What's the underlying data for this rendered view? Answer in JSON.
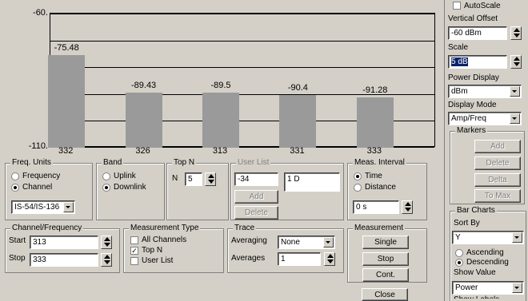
{
  "chart_data": {
    "type": "bar",
    "categories": [
      "332",
      "326",
      "313",
      "331",
      "333"
    ],
    "values": [
      -75.48,
      -89.43,
      -89.5,
      -90.4,
      -91.28
    ],
    "value_labels": [
      "-75.48",
      "-89.43",
      "-89.5",
      "-90.4",
      "-91.28"
    ],
    "ytick_top": "-60.",
    "ytick_bottom": "-110.",
    "ylim": [
      -110,
      -60
    ],
    "gridlines": [
      -60,
      -70,
      -80,
      -90,
      -100,
      -110
    ],
    "bar_color": "#9a9a9a"
  },
  "freq_units": {
    "title": "Freq. Units",
    "opt1": "Frequency",
    "opt2": "Channel",
    "standard": "IS-54/IS-136"
  },
  "band": {
    "title": "Band",
    "opt1": "Uplink",
    "opt2": "Downlink"
  },
  "topn": {
    "title": "Top N",
    "label": "N",
    "value": "5"
  },
  "user_list": {
    "title": "User List",
    "value": "-34",
    "list_item": "1 D",
    "add": "Add",
    "delete": "Delete"
  },
  "meas_interval": {
    "title": "Meas. Interval",
    "opt1": "Time",
    "opt2": "Distance",
    "value": "0 s"
  },
  "channel_freq": {
    "title": "Channel/Frequency",
    "start_label": "Start",
    "start_value": "313",
    "stop_label": "Stop",
    "stop_value": "333"
  },
  "meas_type": {
    "title": "Measurement Type",
    "opt1": "All Channels",
    "opt2": "Top N",
    "opt3": "User List"
  },
  "trace": {
    "title": "Trace",
    "avg_label": "Averaging",
    "avg_value": "None",
    "avgs_label": "Averages",
    "avgs_value": "1"
  },
  "measurement": {
    "title": "Measurement",
    "single": "Single",
    "stop": "Stop",
    "cont": "Cont."
  },
  "close": "Close",
  "right": {
    "autoscale": "AutoScale",
    "vertical_offset": "Vertical Offset",
    "offset_value": "-60 dBm",
    "scale_label": "Scale",
    "scale_value": "5 dB",
    "power_display": "Power Display",
    "power_value": "dBm",
    "display_mode": "Display Mode",
    "mode_value": "Amp/Freq",
    "markers": "Markers",
    "add": "Add",
    "delete": "Delete",
    "delta": "Delta",
    "to_max": "To Max",
    "bar_charts": "Bar Charts",
    "sort_by": "Sort By",
    "sort_value": "Y",
    "ascending": "Ascending",
    "descending": "Descending",
    "show_value": "Show Value",
    "show_value_value": "Power",
    "cut_label": "Show Labels"
  }
}
